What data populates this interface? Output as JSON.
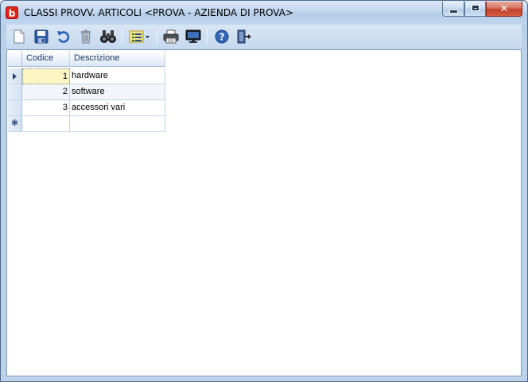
{
  "window": {
    "app_icon_letter": "b",
    "title": "CLASSI PROVV. ARTICOLI <PROVA - AZIENDA DI PROVA>",
    "close_glyph": "✕"
  },
  "toolbar": {
    "buttons": [
      {
        "name": "new-document",
        "icon": "new-document-icon"
      },
      {
        "name": "save",
        "icon": "floppy-save-icon"
      },
      {
        "name": "undo",
        "icon": "undo-arrow-icon"
      },
      {
        "name": "delete",
        "icon": "trash-icon"
      },
      {
        "name": "find",
        "icon": "binoculars-icon"
      },
      {
        "name": "view-options",
        "icon": "list-dropdown-icon"
      },
      {
        "name": "print",
        "icon": "printer-icon"
      },
      {
        "name": "preview",
        "icon": "monitor-icon"
      },
      {
        "name": "help",
        "icon": "help-icon",
        "glyph": "?"
      },
      {
        "name": "exit",
        "icon": "exit-door-icon"
      }
    ]
  },
  "grid": {
    "columns": [
      "Codice",
      "Descrizione"
    ],
    "rows": [
      {
        "codice": "1",
        "descrizione": "hardware",
        "current": true
      },
      {
        "codice": "2",
        "descrizione": "software",
        "current": false
      },
      {
        "codice": "3",
        "descrizione": "accessori vari",
        "current": false
      }
    ],
    "new_row_marker": "✱"
  },
  "colors": {
    "titlebar": "#c3d7ee",
    "toolbar": "#c6d9ef",
    "current_cell": "#fdf6c4",
    "header_text": "#1b3a63",
    "accent_red": "#e2231a"
  }
}
